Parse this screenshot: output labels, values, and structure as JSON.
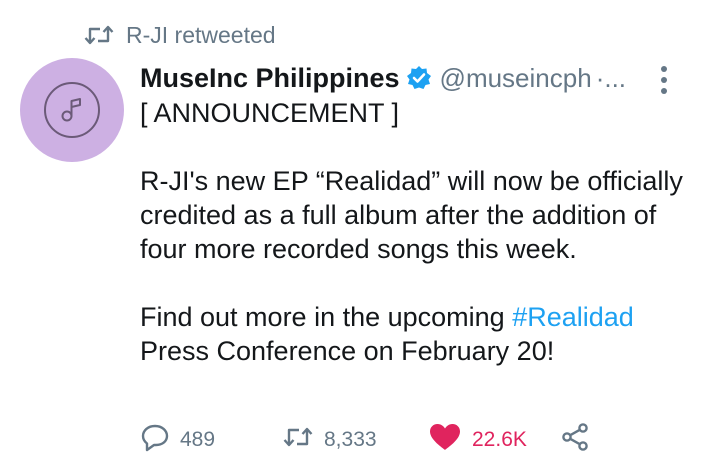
{
  "retweet_context": {
    "text": "R-JI retweeted",
    "icon": "retweet-icon"
  },
  "author": {
    "display_name": "MuseInc Philippines",
    "verified": true,
    "handle": "@museincph",
    "separator": "·...",
    "avatar_color": "#cdb0e3"
  },
  "tweet": {
    "line1": "[ ANNOUNCEMENT ]",
    "paragraph2": "R-JI's new EP “Realidad” will now be officially credited as a full album after the addition of four more recorded songs this week.",
    "paragraph3_prefix": "Find out more in the upcoming ",
    "hashtag": "#Realidad",
    "paragraph3_suffix": " Press Conference on February 20!"
  },
  "actions": {
    "replies": "489",
    "retweets": "8,333",
    "likes": "22.6K",
    "liked": true
  },
  "colors": {
    "accent": "#1da1f2",
    "like": "#e0245e",
    "muted": "#657786"
  }
}
